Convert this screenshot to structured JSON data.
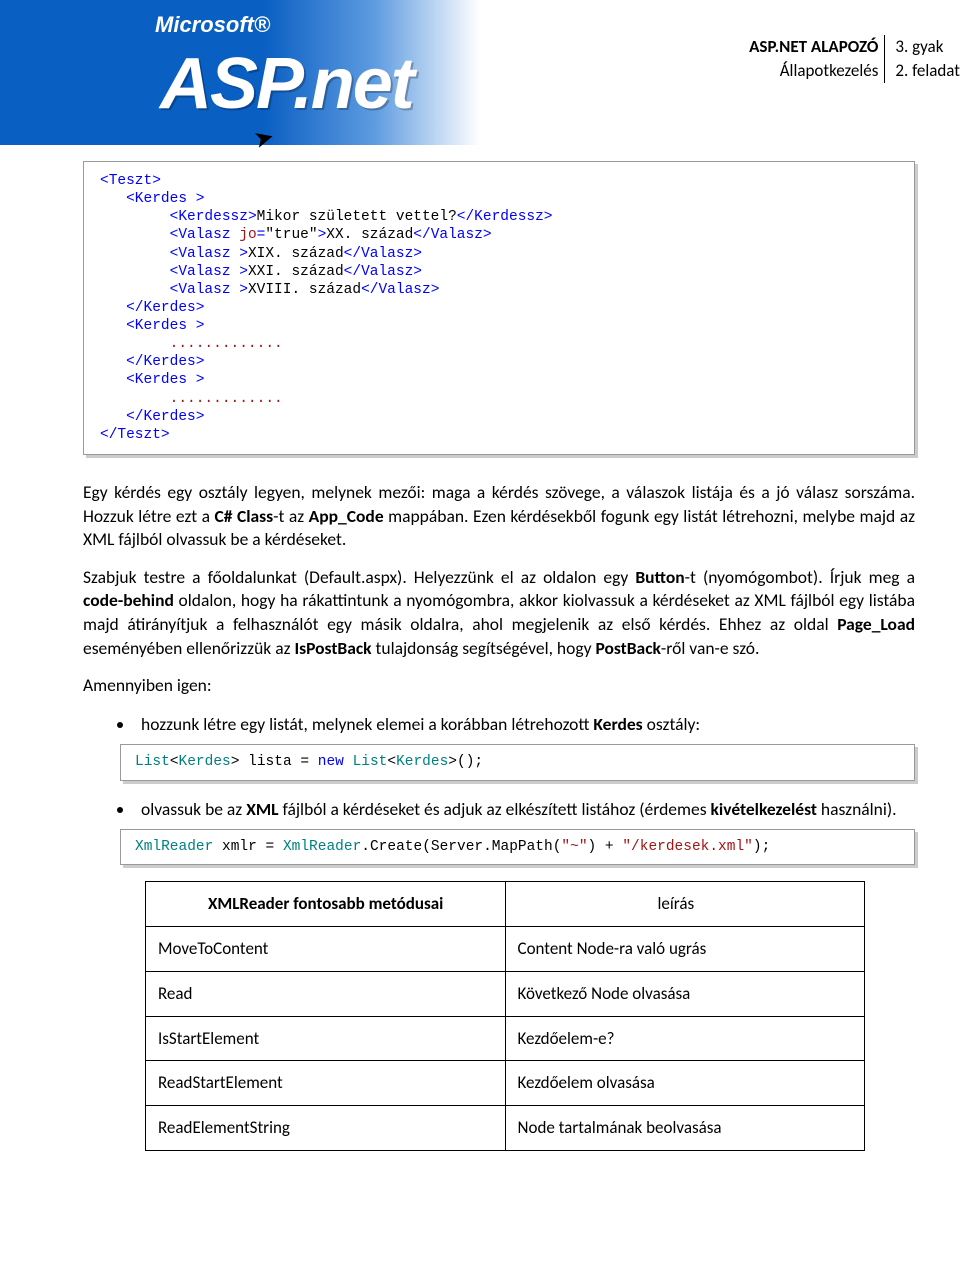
{
  "header": {
    "brand_small": "Microsoft®",
    "brand_large": "ASP.net",
    "title_line1": "ASP.NET ALAPOZÓ",
    "title_line2": "Állapotkezelés",
    "sub_line1": "3. gyak",
    "sub_line2": "2. feladat"
  },
  "codeblock1": "<Teszt>\n   <Kerdes >\n        <Kerdessz>Mikor született vettel?</Kerdessz>\n        <Valasz jo=\"true\">XX. század</Valasz>\n        <Valasz >XIX. század</Valasz>\n        <Valasz >XXI. század</Valasz>\n        <Valasz >XVIII. század</Valasz>\n   </Kerdes>\n   <Kerdes >\n        .............\n   </Kerdes>\n   <Kerdes >\n        .............\n   </Kerdes>\n</Teszt>",
  "para1": "Egy kérdés egy osztály legyen, melynek mezői: maga a kérdés szövege, a válaszok listája és a jó válasz sorszáma. Hozzuk létre ezt a C# Class-t az App_Code mappában. Ezen kérdésekből fogunk egy listát létrehozni, melybe majd az XML fájlból olvassuk be a kérdéseket.",
  "para2": "Szabjuk testre a főoldalunkat (Default.aspx). Helyezzünk el az oldalon egy Button-t (nyomógombot). Írjuk meg a code-behind oldalon, hogy ha rákattintunk a nyomógombra, akkor kiolvassuk a kérdéseket az XML fájlból egy listába majd átirányítjuk a felhasználót egy másik oldalra, ahol megjelenik az első kérdés. Ehhez az oldal Page_Load eseményében ellenőrizzük az IsPostBack tulajdonság segítségével, hogy PostBack-ről van-e szó.",
  "para3": "Amennyiben igen:",
  "bullet1": "hozzunk létre egy listát, melynek elemei a korábban létrehozott Kerdes osztály:",
  "code_small1": "List<Kerdes> lista = new List<Kerdes>();",
  "bullet2": "olvassuk be az XML fájlból a kérdéseket és adjuk az elkészített listához (érdemes kivételkezelést használni).",
  "code_small2": "XmlReader xmlr = XmlReader.Create(Server.MapPath(\"~\") + \"/kerdesek.xml\");",
  "table": {
    "heading1": "XMLReader fontosabb metódusai",
    "heading2": "leírás",
    "rows": [
      {
        "m": "MoveToContent",
        "d": "Content Node-ra való ugrás"
      },
      {
        "m": "Read",
        "d": "Következő Node olvasása"
      },
      {
        "m": "IsStartElement",
        "d": "Kezdőelem-e?"
      },
      {
        "m": "ReadStartElement",
        "d": "Kezdőelem olvasása"
      },
      {
        "m": "ReadElementString",
        "d": "Node tartalmának beolvasása"
      }
    ]
  }
}
